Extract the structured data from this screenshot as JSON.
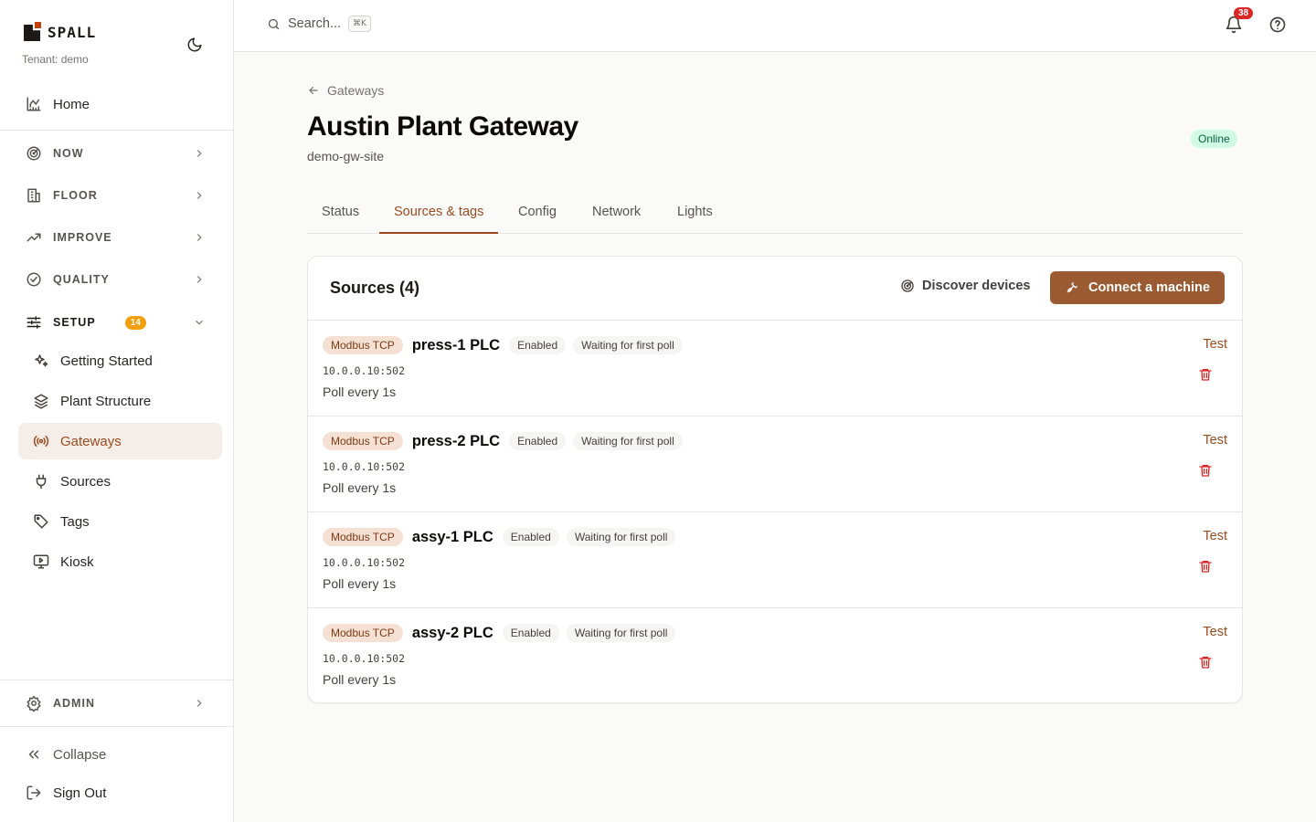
{
  "brand": {
    "word": "SPALL",
    "tenant": "Tenant: demo"
  },
  "sidebar": {
    "home": "Home",
    "sections": [
      {
        "label": "NOW"
      },
      {
        "label": "FLOOR"
      },
      {
        "label": "IMPROVE"
      },
      {
        "label": "QUALITY"
      }
    ],
    "setup": {
      "label": "SETUP",
      "badge": "14"
    },
    "setup_items": [
      {
        "label": "Getting Started"
      },
      {
        "label": "Plant Structure"
      },
      {
        "label": "Gateways"
      },
      {
        "label": "Sources"
      },
      {
        "label": "Tags"
      },
      {
        "label": "Kiosk"
      }
    ],
    "admin": "ADMIN",
    "collapse": "Collapse",
    "sign_out": "Sign Out"
  },
  "topbar": {
    "search_placeholder": "Search...",
    "shortcut": "⌘K",
    "notifications": "38"
  },
  "page": {
    "back": "Gateways",
    "title": "Austin Plant Gateway",
    "subtitle": "demo-gw-site",
    "status": "Online",
    "status_color": "#065f46"
  },
  "tabs": [
    "Status",
    "Sources & tags",
    "Config",
    "Network",
    "Lights"
  ],
  "card": {
    "title": "Sources (4)",
    "discover": "Discover devices",
    "connect": "Connect a machine",
    "accent": "#9a5a32"
  },
  "sources": [
    {
      "protocol": "Modbus TCP",
      "name": "press-1 PLC",
      "state": "Enabled",
      "poll_state": "Waiting for first poll",
      "address": "10.0.0.10:502",
      "poll": "Poll every 1s",
      "test": "Test"
    },
    {
      "protocol": "Modbus TCP",
      "name": "press-2 PLC",
      "state": "Enabled",
      "poll_state": "Waiting for first poll",
      "address": "10.0.0.10:502",
      "poll": "Poll every 1s",
      "test": "Test"
    },
    {
      "protocol": "Modbus TCP",
      "name": "assy-1 PLC",
      "state": "Enabled",
      "poll_state": "Waiting for first poll",
      "address": "10.0.0.10:502",
      "poll": "Poll every 1s",
      "test": "Test"
    },
    {
      "protocol": "Modbus TCP",
      "name": "assy-2 PLC",
      "state": "Enabled",
      "poll_state": "Waiting for first poll",
      "address": "10.0.0.10:502",
      "poll": "Poll every 1s",
      "test": "Test"
    }
  ]
}
